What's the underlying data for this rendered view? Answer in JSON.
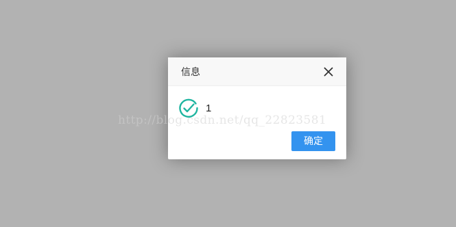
{
  "dialog": {
    "title": "信息",
    "message": "1",
    "confirm_label": "确定"
  },
  "icons": {
    "close": "close-icon",
    "status": "check-circle-icon"
  },
  "colors": {
    "backdrop": "#b2b2b2",
    "header_bg": "#f8f8f8",
    "success": "#1fb5a0",
    "primary_button": "#3393ef"
  },
  "watermark": "http://blog.csdn.net/qq_22823581"
}
